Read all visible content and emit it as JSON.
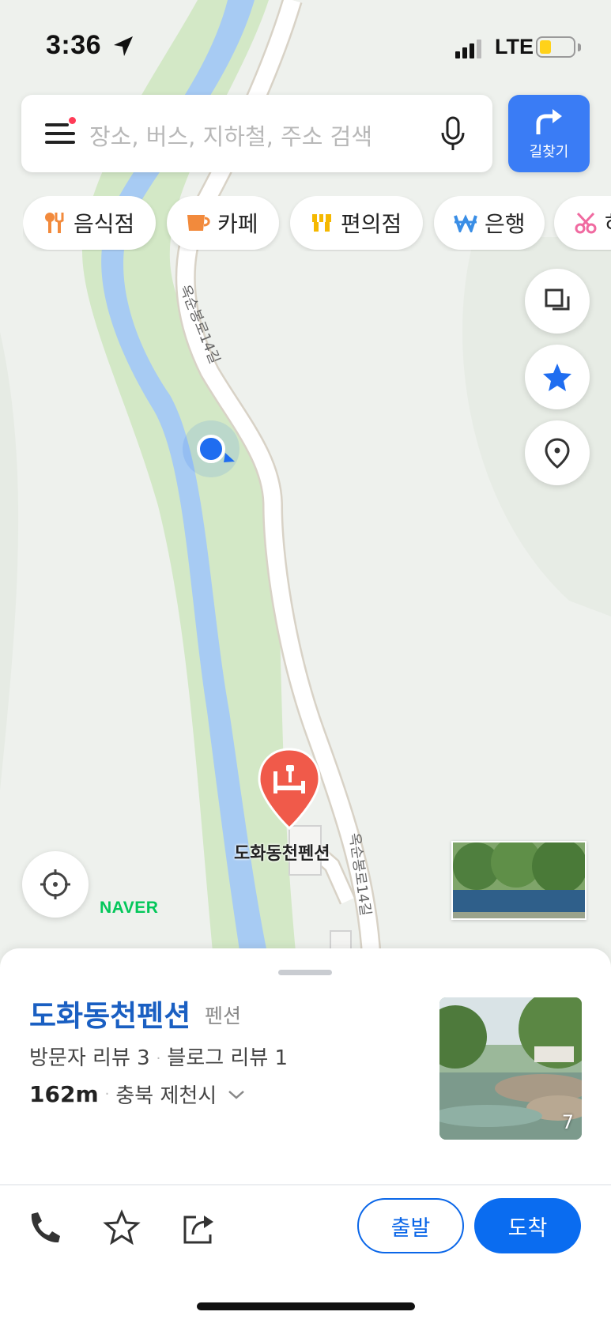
{
  "status_bar": {
    "time": "3:36",
    "network": "LTE",
    "battery_level": 0.35
  },
  "search": {
    "placeholder": "장소, 버스, 지하철, 주소 검색"
  },
  "route_button": {
    "label": "길찾기"
  },
  "categories": [
    {
      "label": "음식점",
      "icon": "fork-knife-icon",
      "color": "#f28a3c"
    },
    {
      "label": "카페",
      "icon": "coffee-cup-icon",
      "color": "#f28a3c"
    },
    {
      "label": "편의점",
      "icon": "store-icon",
      "color": "#f5b800"
    },
    {
      "label": "은행",
      "icon": "won-icon",
      "color": "#3a8ee6"
    },
    {
      "label": "하",
      "icon": "scissors-icon",
      "color": "#f06aa0"
    }
  ],
  "map": {
    "road_label_1": "옥순봉로14길",
    "road_label_2": "옥순봉로14길",
    "place_label": "도화동천펜션",
    "brand": "NAVER",
    "colors": {
      "river": "#a9cdf5",
      "green": "#d4eac8",
      "road": "#ffffff",
      "marker": "#f05a4a",
      "location": "#1f6df0"
    }
  },
  "place": {
    "name": "도화동천펜션",
    "category": "펜션",
    "visitor_reviews": "방문자 리뷰 3",
    "blog_reviews": "블로그 리뷰 1",
    "distance": "162m",
    "address": "충북 제천시",
    "photo_count": "7"
  },
  "actions": {
    "depart": "출발",
    "arrive": "도착"
  }
}
